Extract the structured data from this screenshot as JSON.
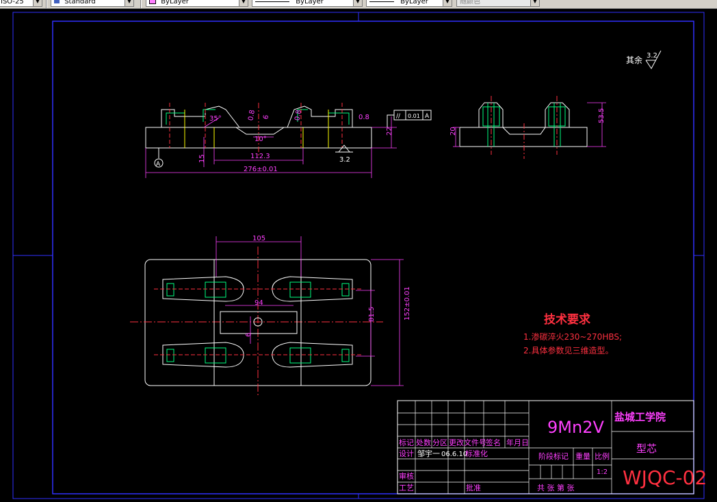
{
  "toolbar": {
    "linetype_scale": "ISO-25",
    "text_style": "Standard",
    "layer_color": "ByLayer",
    "linetype": "ByLayer",
    "lineweight": "ByLayer",
    "plot_style": "随颜色"
  },
  "drawing": {
    "roughness_rest_label": "其余",
    "roughness_rest_value": "3.2",
    "front_view": {
      "angle": "35°",
      "roughness_a": "0.8",
      "roughness_b": "6",
      "roughness_c": "0.8",
      "roughness_d": "0.8",
      "angle_b": "10°",
      "dim_22": "22",
      "dim_15": "15",
      "dim_112": "112.3",
      "dim_276": "276±0.01",
      "datum": "A",
      "roughness_bottom": "3.2",
      "tolerance_symbol": "//",
      "tolerance_value": "0.01",
      "tolerance_datum": "A"
    },
    "side_view": {
      "dim_20": "20",
      "dim_535": "53.5"
    },
    "top_view": {
      "dim_105": "105",
      "dim_94": "94",
      "dim_6": "6",
      "dim_815": "81.5",
      "dim_152": "152±0.01"
    },
    "tech_req": {
      "title": "技术要求",
      "line1": "1.渗碳淬火230~270HBS;",
      "line2": "2.具体参数见三维造型。"
    },
    "title_block": {
      "material": "9Mn2V",
      "school": "盐城工学院",
      "part_name": "型芯",
      "drawing_no": "WJQC-02",
      "scale": "1:2",
      "h_mark": "标记",
      "h_count": "处数",
      "h_zone": "分区",
      "h_doc": "更改文件号",
      "h_sign": "签名",
      "h_date": "年月日",
      "h_design": "设计",
      "designer": "邹宇一",
      "design_date": "06.6.10",
      "h_std": "标准化",
      "h_stage": "阶段标记",
      "h_weight": "重量",
      "h_scale": "比例",
      "h_review": "审核",
      "h_process": "工艺",
      "h_approve": "批准",
      "h_sheets": "共   张 第   张"
    }
  }
}
